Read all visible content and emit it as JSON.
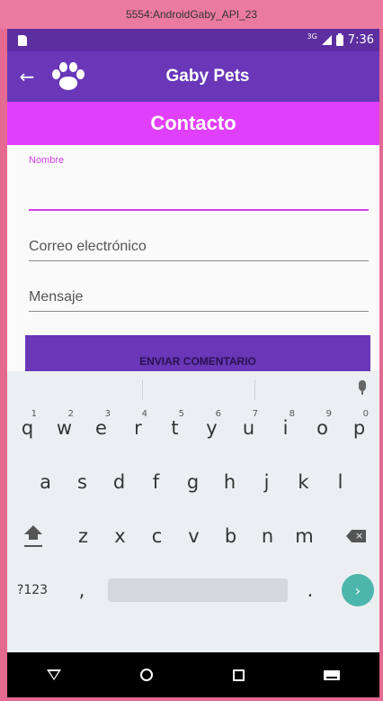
{
  "window": {
    "title": "5554:AndroidGaby_API_23"
  },
  "status_bar": {
    "network": "3G",
    "time": "7:36"
  },
  "app_bar": {
    "title": "Gaby Pets"
  },
  "banner": {
    "title": "Contacto"
  },
  "form": {
    "name_label": "Nombre",
    "name_value": "",
    "email_placeholder": "Correo electrónico",
    "message_placeholder": "Mensaje",
    "submit_label": "ENVIAR COMENTARIO"
  },
  "keyboard": {
    "row1": [
      {
        "key": "q",
        "hint": "1"
      },
      {
        "key": "w",
        "hint": "2"
      },
      {
        "key": "e",
        "hint": "3"
      },
      {
        "key": "r",
        "hint": "4"
      },
      {
        "key": "t",
        "hint": "5"
      },
      {
        "key": "y",
        "hint": "6"
      },
      {
        "key": "u",
        "hint": "7"
      },
      {
        "key": "i",
        "hint": "8"
      },
      {
        "key": "o",
        "hint": "9"
      },
      {
        "key": "p",
        "hint": "0"
      }
    ],
    "row2": [
      "a",
      "s",
      "d",
      "f",
      "g",
      "h",
      "j",
      "k",
      "l"
    ],
    "row3": [
      "z",
      "x",
      "c",
      "v",
      "b",
      "n",
      "m"
    ],
    "symbols_label": "?123",
    "comma": ",",
    "period": "."
  },
  "colors": {
    "status_bar": "#5c2ea0",
    "app_bar": "#6937b8",
    "banner": "#e040fb",
    "accent": "#d040e8",
    "enter_key": "#4db6ac"
  }
}
